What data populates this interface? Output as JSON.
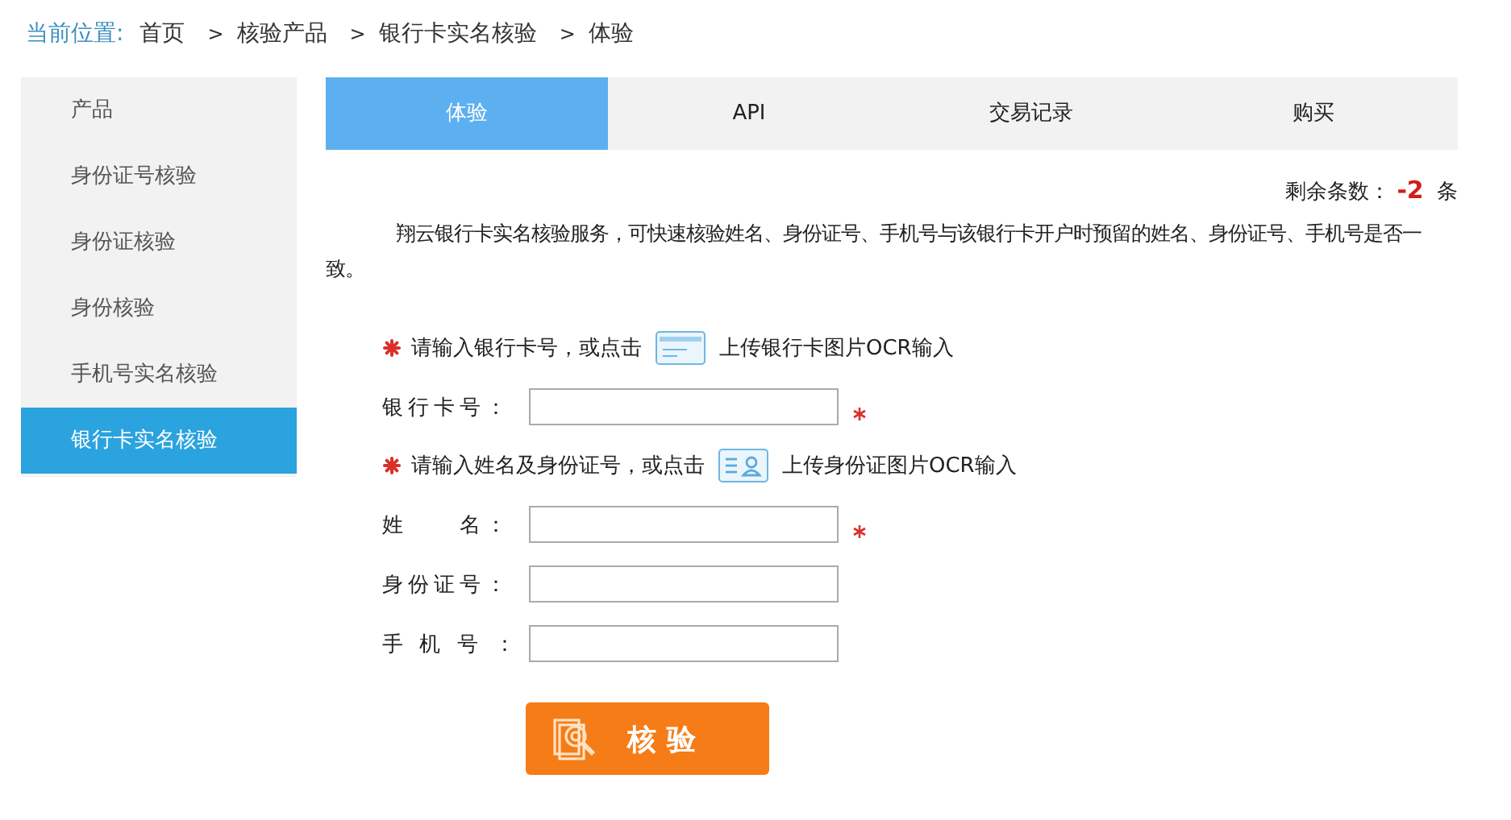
{
  "breadcrumb": {
    "label": "当前位置:",
    "items": [
      "首页",
      "核验产品",
      "银行卡实名核验",
      "体验"
    ],
    "separator": ">"
  },
  "sidebar": {
    "items": [
      {
        "label": "产品",
        "selected": false
      },
      {
        "label": "身份证号核验",
        "selected": false
      },
      {
        "label": "身份证核验",
        "selected": false
      },
      {
        "label": "身份核验",
        "selected": false
      },
      {
        "label": "手机号实名核验",
        "selected": false
      },
      {
        "label": "银行卡实名核验",
        "selected": true
      }
    ]
  },
  "tabs": [
    {
      "label": "体验",
      "selected": true
    },
    {
      "label": "API",
      "selected": false
    },
    {
      "label": "交易记录",
      "selected": false
    },
    {
      "label": "购买",
      "selected": false
    }
  ],
  "quota": {
    "label": "剩余条数：",
    "value": "-2",
    "unit": "条"
  },
  "description": "翔云银行卡实名核验服务，可快速核验姓名、身份证号、手机号与该银行卡开户时预留的姓名、身份证号、手机号是否一致。",
  "form": [
    {
      "kind": "hint",
      "before": "请输入银行卡号，或点击",
      "after": "上传银行卡图片OCR输入"
    },
    {
      "kind": "field",
      "label": "银行卡号：",
      "required": true
    },
    {
      "kind": "hint",
      "before": "请输入姓名及身份证号，或点击",
      "after": "上传身份证图片OCR输入"
    },
    {
      "kind": "field",
      "label": "姓　　名：",
      "required": true
    },
    {
      "kind": "field",
      "label": "身份证号：",
      "required": false
    },
    {
      "kind": "field",
      "label": "手 机 号 ：",
      "required": false
    }
  ],
  "submit": {
    "label": "核 验"
  }
}
